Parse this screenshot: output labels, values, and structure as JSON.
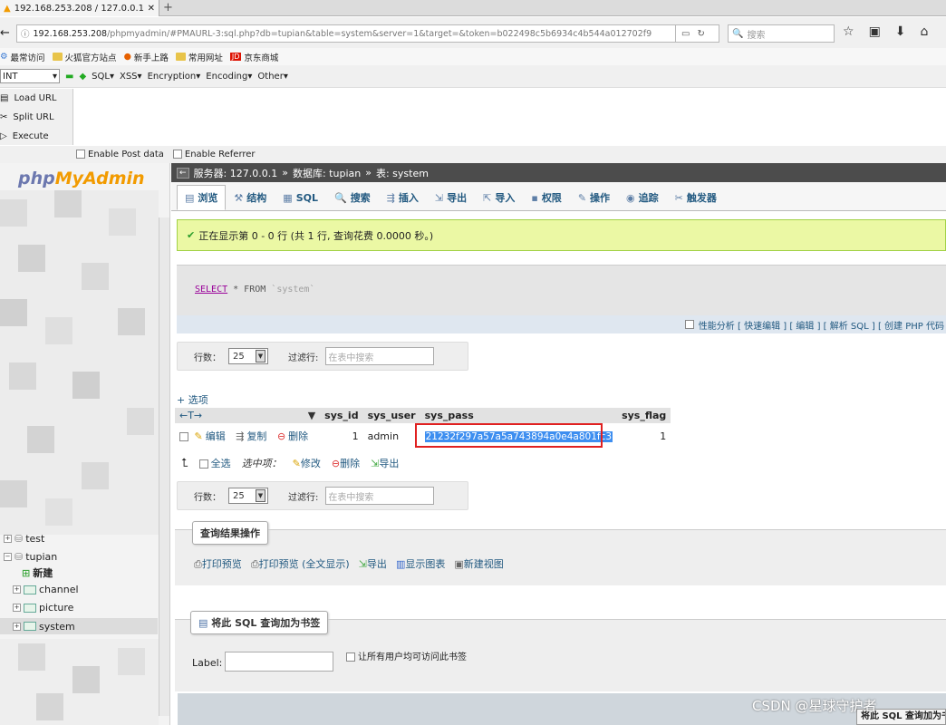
{
  "browser": {
    "tab_title": "192.168.253.208 / 127.0.0.1",
    "url_host": "192.168.253.208",
    "url_path": "/phpmyadmin/#PMAURL-3:sql.php?db=tupian&table=system&server=1&target=&token=b022498c5b6934c4b544a012702f9",
    "search_placeholder": "搜索",
    "bookmarks": [
      "最常访问",
      "火狐官方站点",
      "新手上路",
      "常用网址",
      "京东商城"
    ]
  },
  "hackbar": {
    "select_value": "INT",
    "menus": [
      "SQL",
      "XSS",
      "Encryption",
      "Encoding",
      "Other"
    ],
    "side_buttons": [
      "Load URL",
      "Split URL",
      "Execute"
    ],
    "enable_post": "Enable Post data",
    "enable_referrer": "Enable Referrer"
  },
  "pma": {
    "logo_php": "php",
    "logo_my": "MyAdmin",
    "tree": {
      "db_test": "test",
      "db_tupian": "tupian",
      "new": "新建",
      "tables": [
        "channel",
        "picture",
        "system"
      ]
    },
    "breadcrumb": {
      "server": "服务器: 127.0.0.1",
      "database": "数据库: tupian",
      "table": "表: system"
    },
    "tabs": [
      {
        "label": "浏览",
        "icon": "▤"
      },
      {
        "label": "结构",
        "icon": "⚒"
      },
      {
        "label": "SQL",
        "icon": "▦"
      },
      {
        "label": "搜索",
        "icon": "🔍"
      },
      {
        "label": "插入",
        "icon": "⇶"
      },
      {
        "label": "导出",
        "icon": "⇲"
      },
      {
        "label": "导入",
        "icon": "⇱"
      },
      {
        "label": "权限",
        "icon": "▪"
      },
      {
        "label": "操作",
        "icon": "✎"
      },
      {
        "label": "追踪",
        "icon": "◉"
      },
      {
        "label": "触发器",
        "icon": "✂"
      }
    ],
    "message": "正在显示第 0 - 0 行 (共 1 行, 查询花费 0.0000 秒。)",
    "sql": {
      "select": "SELECT",
      "star_from": " * FROM ",
      "table": "`system`"
    },
    "sql_links": "性能分析 [ 快速编辑 ] [ 编辑 ] [ 解析 SQL ] [ 创建 PHP 代码",
    "nav": {
      "rows_label": "行数：",
      "rows_value": "25",
      "filter_label": "过滤行:",
      "filter_placeholder": "在表中搜索"
    },
    "options_link": "+ 选项",
    "table": {
      "headers": [
        "sys_id",
        "sys_user",
        "sys_pass",
        "sys_flag"
      ],
      "row": {
        "edit": "编辑",
        "copy": "复制",
        "delete": "删除",
        "sys_id": "1",
        "sys_user": "admin",
        "sys_pass": "21232f297a57a5a743894a0e4a801fc3",
        "sys_flag": "1"
      }
    },
    "bulk": {
      "select_all": "全选",
      "selected": "选中项：",
      "modify": "修改",
      "delete": "删除",
      "export": "导出"
    },
    "query_ops": {
      "legend": "查询结果操作",
      "links": [
        "打印预览",
        "打印预览 (全文显示)",
        "导出",
        "显示图表",
        "新建视图"
      ]
    },
    "bookmark": {
      "legend": "将此 SQL 查询加为书签",
      "label": "Label:",
      "public": "让所有用户均可访问此书签",
      "button": "将此 SQL 查询加为书签"
    }
  },
  "watermark": "CSDN @星球守护者"
}
